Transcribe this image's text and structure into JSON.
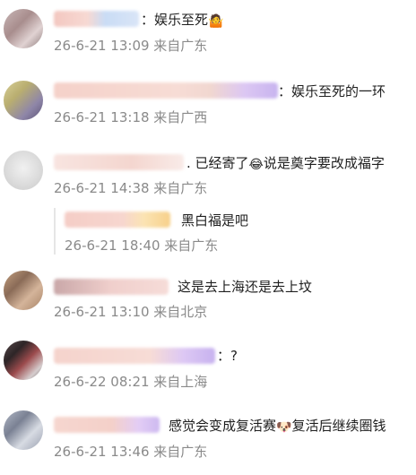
{
  "comments": [
    {
      "text": "：娱乐至死",
      "emoji": "🤷",
      "meta": "26-6-21 13:09 来自广东"
    },
    {
      "text": "：娱乐至死的一环",
      "meta": "26-6-21 13:18 来自广西"
    },
    {
      "text": ". 已经寄了",
      "emoji": "😂",
      "text2": "说是奠字要改成福字",
      "meta": "26-6-21 14:38 来自广东"
    },
    {
      "reply_text": "黑白福是吧",
      "meta": "26-6-21 18:40 来自广东"
    },
    {
      "text": "这是去上海还是去上坟",
      "meta": "26-6-21 13:10 来自北京"
    },
    {
      "text": "：?",
      "meta": "26-6-22 08:21 来自上海"
    },
    {
      "text": "感觉会变成复活赛",
      "emoji": "🐶",
      "text2": "复活后继续圈钱",
      "meta": "26-6-21 13:46 来自广东"
    }
  ]
}
